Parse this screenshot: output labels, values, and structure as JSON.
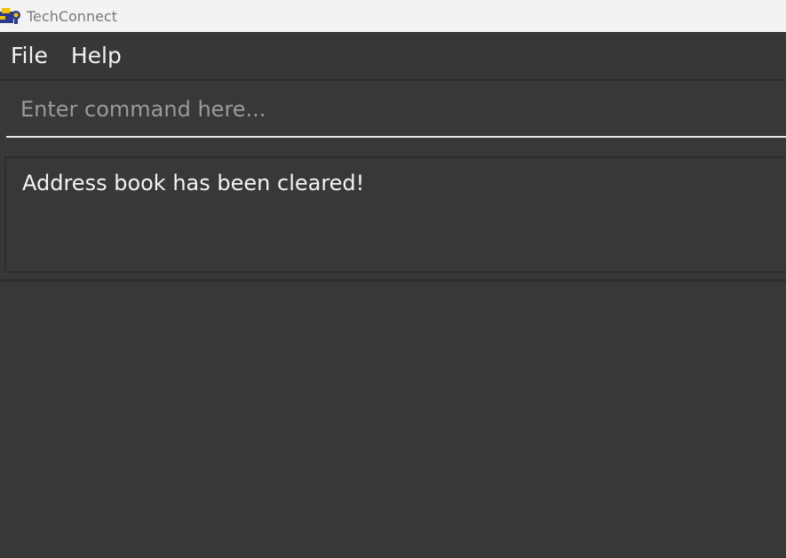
{
  "window": {
    "title": "TechConnect",
    "icon": "app-logo-icon"
  },
  "menubar": {
    "items": [
      {
        "label": "File"
      },
      {
        "label": "Help"
      }
    ]
  },
  "command": {
    "placeholder": "Enter command here...",
    "value": ""
  },
  "result": {
    "message": "Address book has been cleared!"
  },
  "colors": {
    "titlebar_bg": "#f3f3f3",
    "app_bg": "#383838",
    "text": "#f4f4f4",
    "placeholder": "#9a9a9a"
  }
}
